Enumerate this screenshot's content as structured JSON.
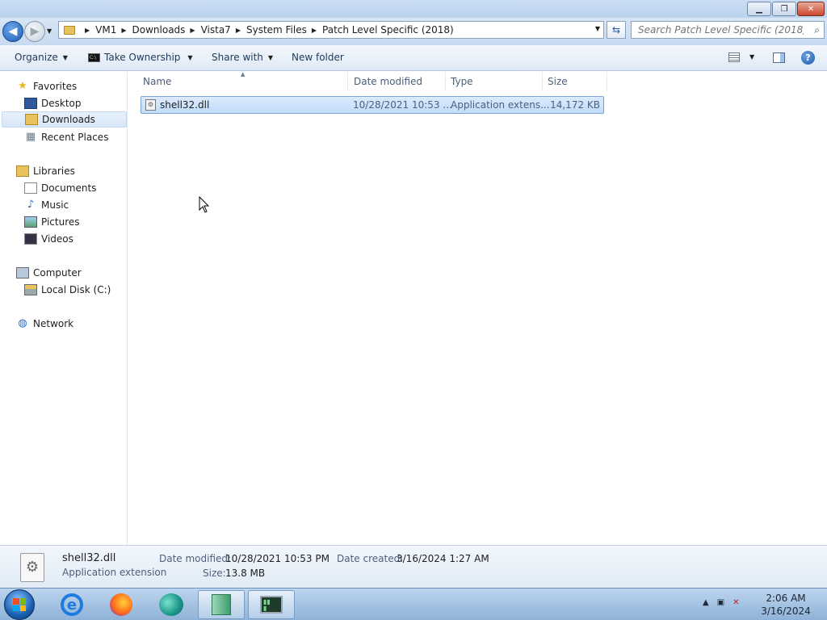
{
  "window": {
    "minimize_glyph": "▁",
    "maximize_glyph": "❐",
    "close_glyph": "✕"
  },
  "address": {
    "breadcrumbs": [
      "VM1",
      "Downloads",
      "Vista7",
      "System Files",
      "Patch Level Specific (2018)"
    ],
    "search_placeholder": "Search Patch Level Specific (2018)"
  },
  "toolbar": {
    "organize": "Organize",
    "take_ownership": "Take Ownership",
    "share_with": "Share with",
    "new_folder": "New folder"
  },
  "sidebar": {
    "favorites": "Favorites",
    "desktop": "Desktop",
    "downloads": "Downloads",
    "recent_places": "Recent Places",
    "libraries": "Libraries",
    "documents": "Documents",
    "music": "Music",
    "pictures": "Pictures",
    "videos": "Videos",
    "computer": "Computer",
    "local_disk": "Local Disk (C:)",
    "network": "Network"
  },
  "columns": {
    "name": "Name",
    "date_modified": "Date modified",
    "type": "Type",
    "size": "Size"
  },
  "files": [
    {
      "name": "shell32.dll",
      "date_modified": "10/28/2021 10:53 ...",
      "type": "Application extens...",
      "size": "14,172 KB"
    }
  ],
  "details": {
    "filename": "shell32.dll",
    "filetype": "Application extension",
    "date_modified_label": "Date modified:",
    "date_modified_value": "10/28/2021 10:53 PM",
    "date_created_label": "Date created:",
    "date_created_value": "3/16/2024 1:27 AM",
    "size_label": "Size:",
    "size_value": "13.8 MB"
  },
  "taskbar": {
    "time": "2:06 AM",
    "date": "3/16/2024"
  },
  "colors": {
    "selection": "#c1dcfc",
    "selection_border": "#7da2ce",
    "titlebar": "#c9dcf2",
    "taskbar": "#8fb2d8"
  }
}
